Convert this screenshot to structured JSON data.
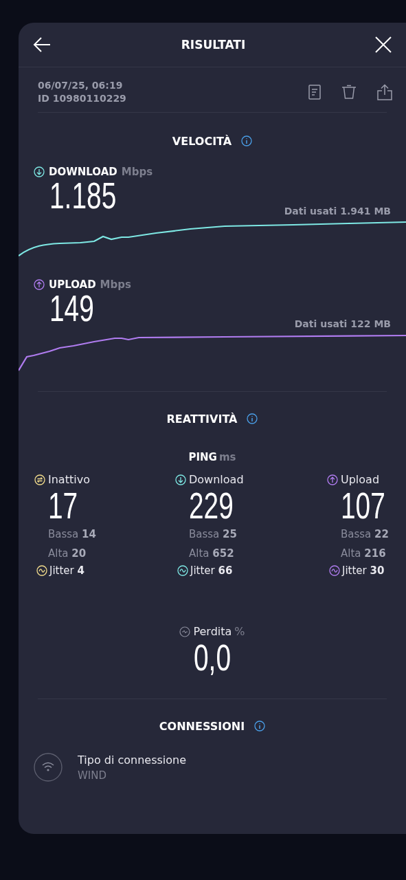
{
  "header": {
    "title": "RISULTATI"
  },
  "meta": {
    "date": "06/07/25, 06:19",
    "id": "ID 10980110229"
  },
  "speed": {
    "title": "VELOCITÀ",
    "tests": [
      {
        "kind": "download",
        "label": "DOWNLOAD",
        "unit": "Mbps",
        "value": "1.185",
        "data_used": "Dati usati 1.941 MB",
        "color": "#7ee8e4"
      },
      {
        "kind": "upload",
        "label": "UPLOAD",
        "unit": "Mbps",
        "value": "149",
        "data_used": "Dati usati 122 MB",
        "color": "#b07cf0"
      }
    ]
  },
  "responsiveness": {
    "title": "REATTIVITÀ",
    "ping_label": "PING",
    "ping_unit": "ms",
    "columns": [
      {
        "kind": "idle",
        "label": "Inattivo",
        "value": "17",
        "low_label": "Bassa",
        "low": "14",
        "high_label": "Alta",
        "high": "20",
        "jitter_label": "Jitter",
        "jitter": "4",
        "color": "#f2dc8c"
      },
      {
        "kind": "download",
        "label": "Download",
        "value": "229",
        "low_label": "Bassa",
        "low": "25",
        "high_label": "Alta",
        "high": "652",
        "jitter_label": "Jitter",
        "jitter": "66",
        "color": "#7ee8e4"
      },
      {
        "kind": "upload",
        "label": "Upload",
        "value": "107",
        "low_label": "Bassa",
        "low": "22",
        "high_label": "Alta",
        "high": "216",
        "jitter_label": "Jitter",
        "jitter": "30",
        "color": "#b07cf0"
      }
    ],
    "loss": {
      "label": "Perdita",
      "unit": "%",
      "value": "0,0"
    }
  },
  "connections": {
    "title": "CONNESSIONI",
    "items": [
      {
        "label": "Tipo di connessione",
        "value": "WIND"
      }
    ]
  }
}
